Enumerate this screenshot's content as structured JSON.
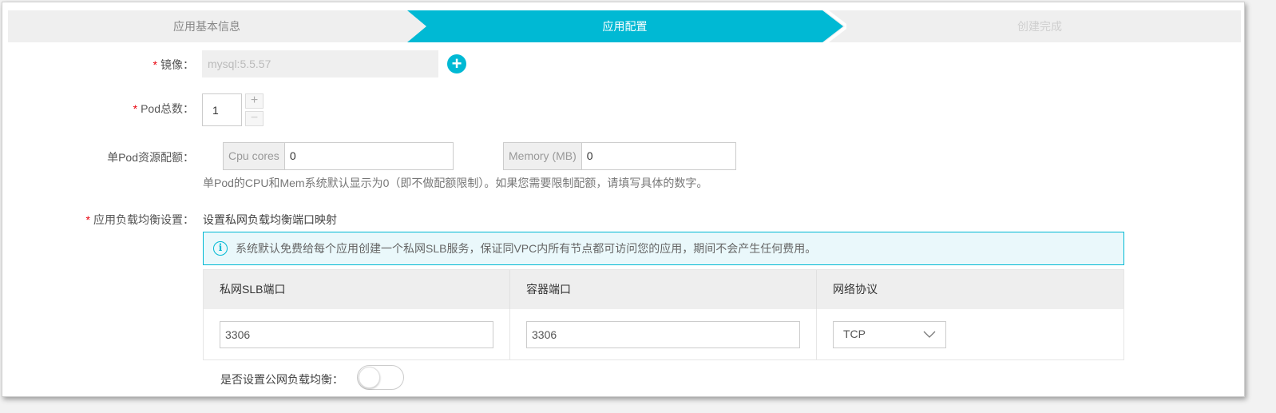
{
  "steps": [
    {
      "label": "应用基本信息",
      "state": "done"
    },
    {
      "label": "应用配置",
      "state": "active"
    },
    {
      "label": "创建完成",
      "state": "pending"
    }
  ],
  "colors": {
    "accent": "#00b9d4",
    "required": "#e8000b"
  },
  "form": {
    "image": {
      "required_mark": "*",
      "label": "镜像：",
      "value": "mysql:5.5.57",
      "add_icon": "plus-circle-icon"
    },
    "pod_count": {
      "required_mark": "*",
      "label": "Pod总数：",
      "value": "1",
      "plus": "+",
      "minus": "−"
    },
    "quota": {
      "label": "单Pod资源配额：",
      "cpu_addon": "Cpu cores",
      "cpu_value": "0",
      "mem_addon": "Memory (MB)",
      "mem_value": "0",
      "hint": "单Pod的CPU和Mem系统默认显示为0（即不做配额限制）。如果您需要限制配额，请填写具体的数字。"
    },
    "lb": {
      "required_mark": "*",
      "label": "应用负载均衡设置：",
      "sublabel": "设置私网负载均衡端口映射",
      "notice_icon": "info-icon",
      "notice": "系统默认免费给每个应用创建一个私网SLB服务，保证同VPC内所有节点都可访问您的应用，期间不会产生任何费用。",
      "table": {
        "headers": [
          "私网SLB端口",
          "容器端口",
          "网络协议"
        ],
        "row": {
          "slb_port": "3306",
          "container_port": "3306",
          "protocol": "TCP"
        }
      },
      "public_lb_label": "是否设置公网负载均衡：",
      "public_lb_enabled": false
    }
  }
}
